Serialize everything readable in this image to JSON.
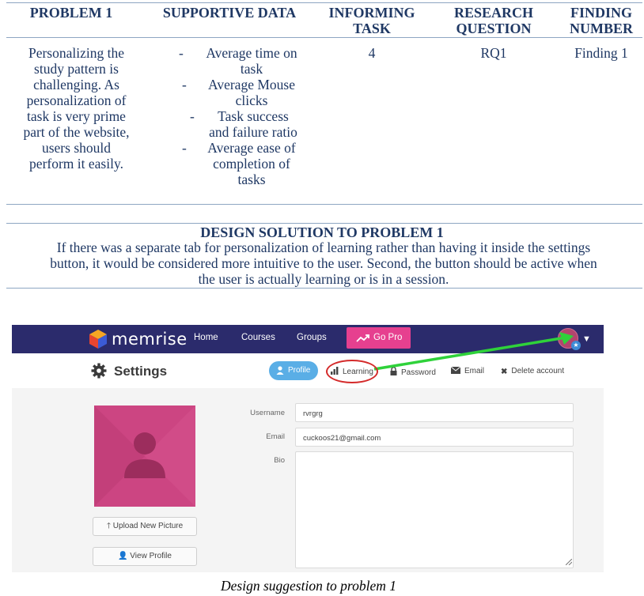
{
  "table": {
    "headers": [
      "PROBLEM 1",
      "SUPPORTIVE DATA",
      "INFORMING TASK",
      "RESEARCH QUESTION",
      "FINDING NUMBER"
    ],
    "row": {
      "problem": [
        "Personalizing the",
        "study pattern is",
        "challenging. As",
        "personalization of",
        "task is very prime",
        "part of the website,",
        "users should",
        "perform it easily."
      ],
      "supportive_data": [
        {
          "dash": "-",
          "lines": [
            "Average time on",
            "task"
          ]
        },
        {
          "dash": "-",
          "lines": [
            "Average Mouse",
            "clicks"
          ]
        },
        {
          "dash": "-",
          "lines": [
            "Task success",
            "and failure ratio"
          ]
        },
        {
          "dash": "-",
          "lines": [
            "Average ease of",
            "completion of",
            "tasks"
          ]
        }
      ],
      "informing_task": "4",
      "research_question": "RQ1",
      "finding_number": "Finding 1"
    }
  },
  "design_solution": {
    "title": "DESIGN SOLUTION TO PROBLEM 1",
    "lines": [
      "If there was a separate tab for personalization of learning rather than having it inside the settings",
      "button, it would be considered more intuitive to the user. Second, the button should be active when",
      "the user is actually learning or is in a session."
    ]
  },
  "screenshot": {
    "nav": {
      "logo": "memrise",
      "links": [
        "Home",
        "Courses",
        "Groups"
      ],
      "go_pro": "Go Pro"
    },
    "settings_title": "Settings",
    "tabs": {
      "profile": "Profile",
      "learning": "Learning",
      "password": "Password",
      "email": "Email",
      "delete": "Delete account"
    },
    "buttons": {
      "upload": "Upload New Picture",
      "view_profile": "View Profile"
    },
    "form": {
      "username_label": "Username",
      "username_value": "rvrgrg",
      "email_label": "Email",
      "email_value": "cuckoos21@gmail.com",
      "bio_label": "Bio"
    },
    "colors": {
      "nav_bg": "#2b2b6c",
      "go_pro": "#e6408f",
      "profile_pill": "#5aaee6",
      "avatar_pink": "#cc4582",
      "annotation_red": "#d42a2a",
      "annotation_green": "#2fd23a"
    }
  },
  "caption": "Design suggestion to problem 1"
}
